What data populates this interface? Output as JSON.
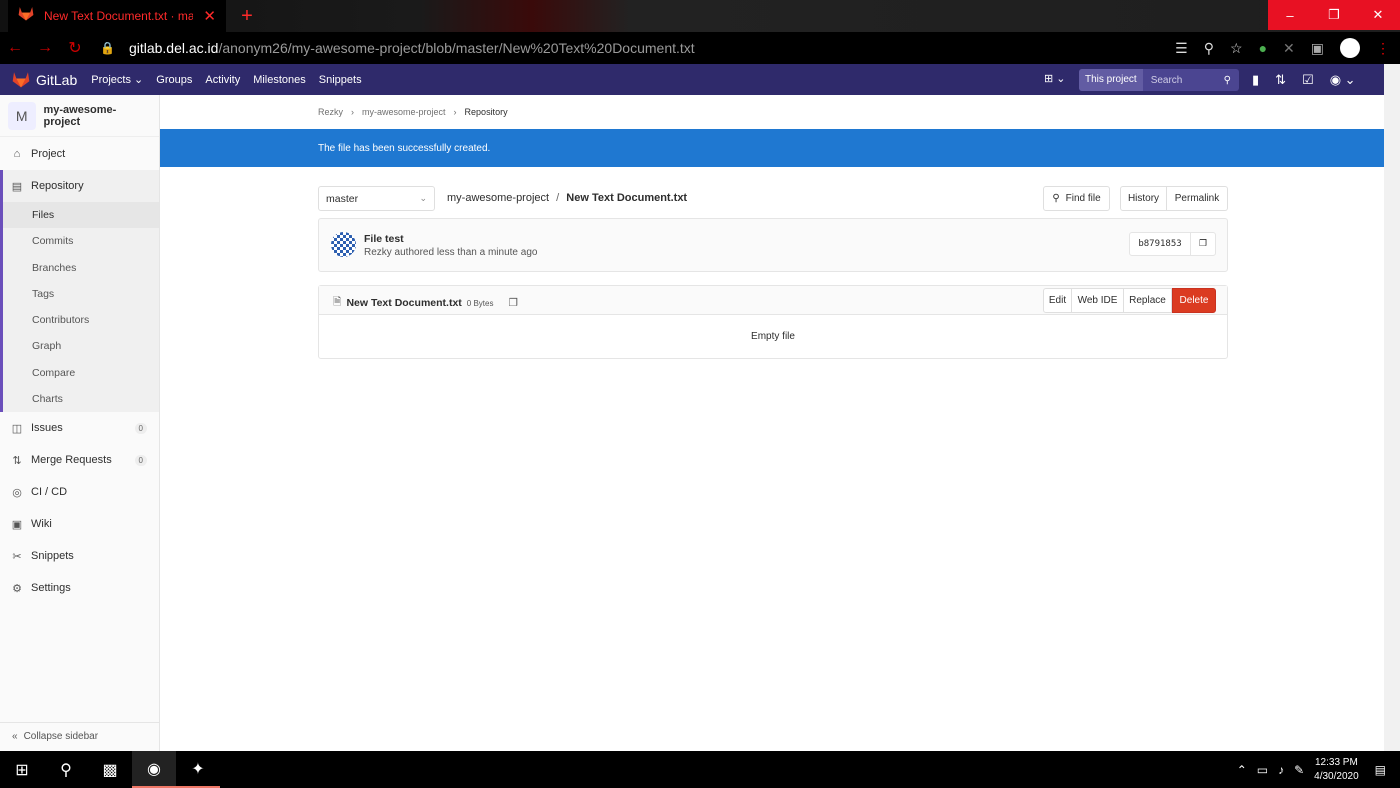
{
  "browser": {
    "tab_title": "New Text Document.txt · master",
    "tab_close": "✕",
    "new_tab": "+",
    "url_host": "gitlab.del.ac.id",
    "url_path": "/anonym26/my-awesome-project/blob/master/New%20Text%20Document.txt",
    "window_controls": [
      "–",
      "❐",
      "✕"
    ]
  },
  "header": {
    "brand": "GitLab",
    "nav": [
      "Projects",
      "Groups",
      "Activity",
      "Milestones",
      "Snippets"
    ],
    "search_scope": "This project",
    "search_placeholder": "Search"
  },
  "sidebar": {
    "project_initial": "M",
    "project_name": "my-awesome-project",
    "project": "Project",
    "repository": "Repository",
    "repo_items": [
      "Files",
      "Commits",
      "Branches",
      "Tags",
      "Contributors",
      "Graph",
      "Compare",
      "Charts"
    ],
    "issues": "Issues",
    "issues_count": "0",
    "merge_requests": "Merge Requests",
    "mr_count": "0",
    "cicd": "CI / CD",
    "wiki": "Wiki",
    "snippets": "Snippets",
    "settings": "Settings",
    "collapse": "Collapse sidebar"
  },
  "breadcrumb": [
    "Rezky",
    "my-awesome-project",
    "Repository"
  ],
  "flash": "The file has been successfully created.",
  "toolbar": {
    "branch": "master",
    "path_project": "my-awesome-project",
    "path_sep": "/",
    "path_file": "New Text Document.txt",
    "find_file": "Find file",
    "history": "History",
    "permalink": "Permalink"
  },
  "commit": {
    "title": "File test",
    "meta": "Rezky authored less than a minute ago",
    "sha": "b8791853"
  },
  "blob": {
    "file_name": "New Text Document.txt",
    "file_size": "0 Bytes",
    "edit": "Edit",
    "web_ide": "Web IDE",
    "replace": "Replace",
    "delete": "Delete",
    "body": "Empty file"
  },
  "taskbar": {
    "time": "12:33 PM",
    "date": "4/30/2020"
  },
  "colors": {
    "gitlab_header": "#2f2a6b",
    "flash": "#1f78d1",
    "delete": "#db3b21",
    "active_border": "#6b4fbb"
  }
}
